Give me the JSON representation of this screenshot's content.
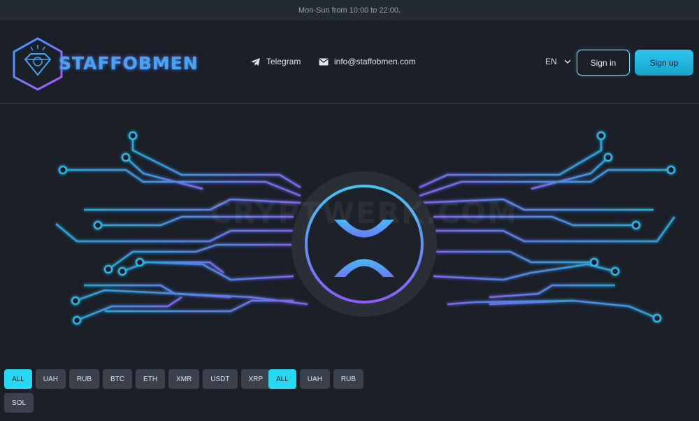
{
  "topbar": {
    "hours": "Mon-Sun from 10:00 to 22:00."
  },
  "header": {
    "logo_text": "STAFFOBMEN",
    "telegram": {
      "icon": "telegram-icon",
      "label": "Telegram"
    },
    "email": {
      "icon": "mail-icon",
      "label": "info@staffobmen.com"
    },
    "language": {
      "value": "EN",
      "icon": "chevron-down-icon"
    },
    "signin_label": "Sign in",
    "signup_label": "Sign up"
  },
  "hero": {
    "coin_icon": "xrp-icon",
    "watermark": "CRYPTWERK.COM"
  },
  "filters_left": {
    "row1": [
      {
        "label": "ALL",
        "active": true
      },
      {
        "label": "UAH",
        "active": false
      },
      {
        "label": "RUB",
        "active": false
      },
      {
        "label": "BTC",
        "active": false
      },
      {
        "label": "ETH",
        "active": false
      },
      {
        "label": "XMR",
        "active": false
      },
      {
        "label": "USDT",
        "active": false
      },
      {
        "label": "XRP",
        "active": false
      }
    ],
    "row2": [
      {
        "label": "SOL",
        "active": false
      }
    ]
  },
  "filters_right": [
    {
      "label": "ALL",
      "active": true
    },
    {
      "label": "UAH",
      "active": false
    },
    {
      "label": "RUB",
      "active": false
    }
  ],
  "colors": {
    "accent": "#25d9f2",
    "background": "#1a1f28",
    "circuit_cyan": "#2fb6e6",
    "circuit_violet": "#7a68f0"
  }
}
